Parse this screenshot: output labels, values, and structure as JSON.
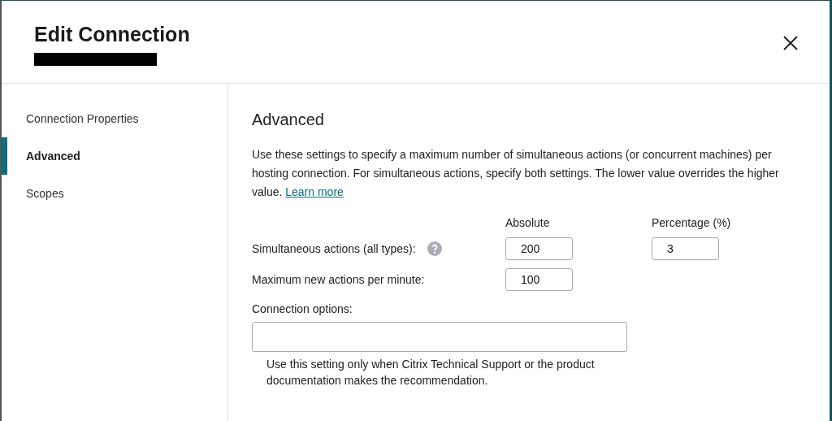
{
  "dialog": {
    "title": "Edit Connection",
    "subtitle_redacted": true
  },
  "sidebar": {
    "items": [
      {
        "label": "Connection Properties",
        "selected": false
      },
      {
        "label": "Advanced",
        "selected": true
      },
      {
        "label": "Scopes",
        "selected": false
      }
    ]
  },
  "panel": {
    "heading": "Advanced",
    "description": "Use these settings to specify a maximum number of simultaneous actions (or concurrent machines) per hosting connection. For simultaneous actions, specify both settings. The lower value overrides the higher value.",
    "learn_more": "Learn more",
    "columns": [
      "Absolute",
      "Percentage (%)"
    ],
    "settings": [
      {
        "label": "Simultaneous actions (all types):",
        "help": true,
        "absolute": "200",
        "percentage": "3"
      },
      {
        "label": "Maximum new actions per minute:",
        "help": false,
        "absolute": "100"
      }
    ],
    "connection_options": {
      "label": "Connection options:",
      "note": "Use this setting only when Citrix Technical Support or the product documentation makes the recommendation."
    }
  }
}
